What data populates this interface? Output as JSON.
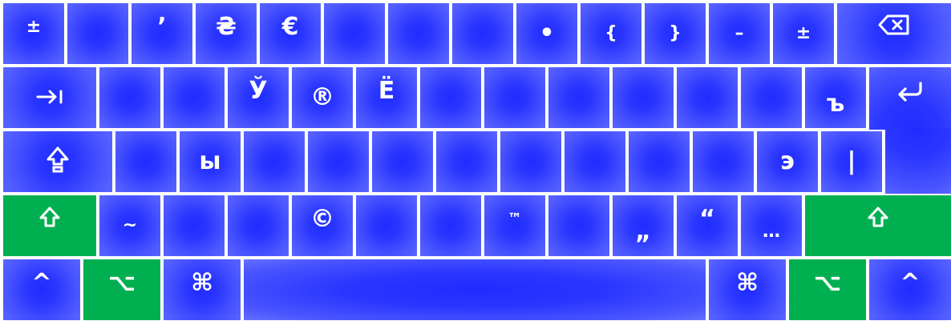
{
  "rows": [
    {
      "keys": [
        {
          "label": "±"
        },
        {
          "label": ""
        },
        {
          "label": "’"
        },
        {
          "label": "₴"
        },
        {
          "label": "€"
        },
        {
          "label": ""
        },
        {
          "label": ""
        },
        {
          "label": ""
        },
        {
          "label": "•"
        },
        {
          "label": "{"
        },
        {
          "label": "}"
        },
        {
          "label": "–"
        },
        {
          "label": "±"
        },
        {
          "label": "⌫",
          "icon": "backspace-icon"
        }
      ]
    },
    {
      "keys": [
        {
          "label": "⇥",
          "icon": "tab-icon"
        },
        {
          "label": ""
        },
        {
          "label": ""
        },
        {
          "label": "Ў"
        },
        {
          "label": "®"
        },
        {
          "label": "Ё"
        },
        {
          "label": ""
        },
        {
          "label": ""
        },
        {
          "label": ""
        },
        {
          "label": ""
        },
        {
          "label": ""
        },
        {
          "label": ""
        },
        {
          "label": "ъ"
        },
        {
          "label": "↩",
          "icon": "return-icon"
        }
      ]
    },
    {
      "keys": [
        {
          "label": "⇪",
          "icon": "caps-lock-icon"
        },
        {
          "label": ""
        },
        {
          "label": "ы"
        },
        {
          "label": ""
        },
        {
          "label": ""
        },
        {
          "label": ""
        },
        {
          "label": ""
        },
        {
          "label": ""
        },
        {
          "label": ""
        },
        {
          "label": ""
        },
        {
          "label": ""
        },
        {
          "label": "э"
        },
        {
          "label": "|"
        }
      ]
    },
    {
      "keys": [
        {
          "label": "⇧",
          "icon": "shift-icon"
        },
        {
          "label": "~"
        },
        {
          "label": ""
        },
        {
          "label": ""
        },
        {
          "label": "©"
        },
        {
          "label": ""
        },
        {
          "label": ""
        },
        {
          "label": "™"
        },
        {
          "label": ""
        },
        {
          "label": "„"
        },
        {
          "label": "“"
        },
        {
          "label": "…"
        },
        {
          "label": "⇧",
          "icon": "shift-icon"
        }
      ]
    },
    {
      "keys": [
        {
          "label": "^",
          "icon": "control-icon"
        },
        {
          "label": "⌥",
          "icon": "option-icon"
        },
        {
          "label": "⌘",
          "icon": "command-icon"
        },
        {
          "label": ""
        },
        {
          "label": "⌘",
          "icon": "command-icon"
        },
        {
          "label": "⌥",
          "icon": "option-icon"
        },
        {
          "label": "^",
          "icon": "control-icon"
        }
      ]
    }
  ],
  "colors": {
    "key_blue": "#2a36ff",
    "modifier_green": "#00b050",
    "background": "#ffffff"
  }
}
